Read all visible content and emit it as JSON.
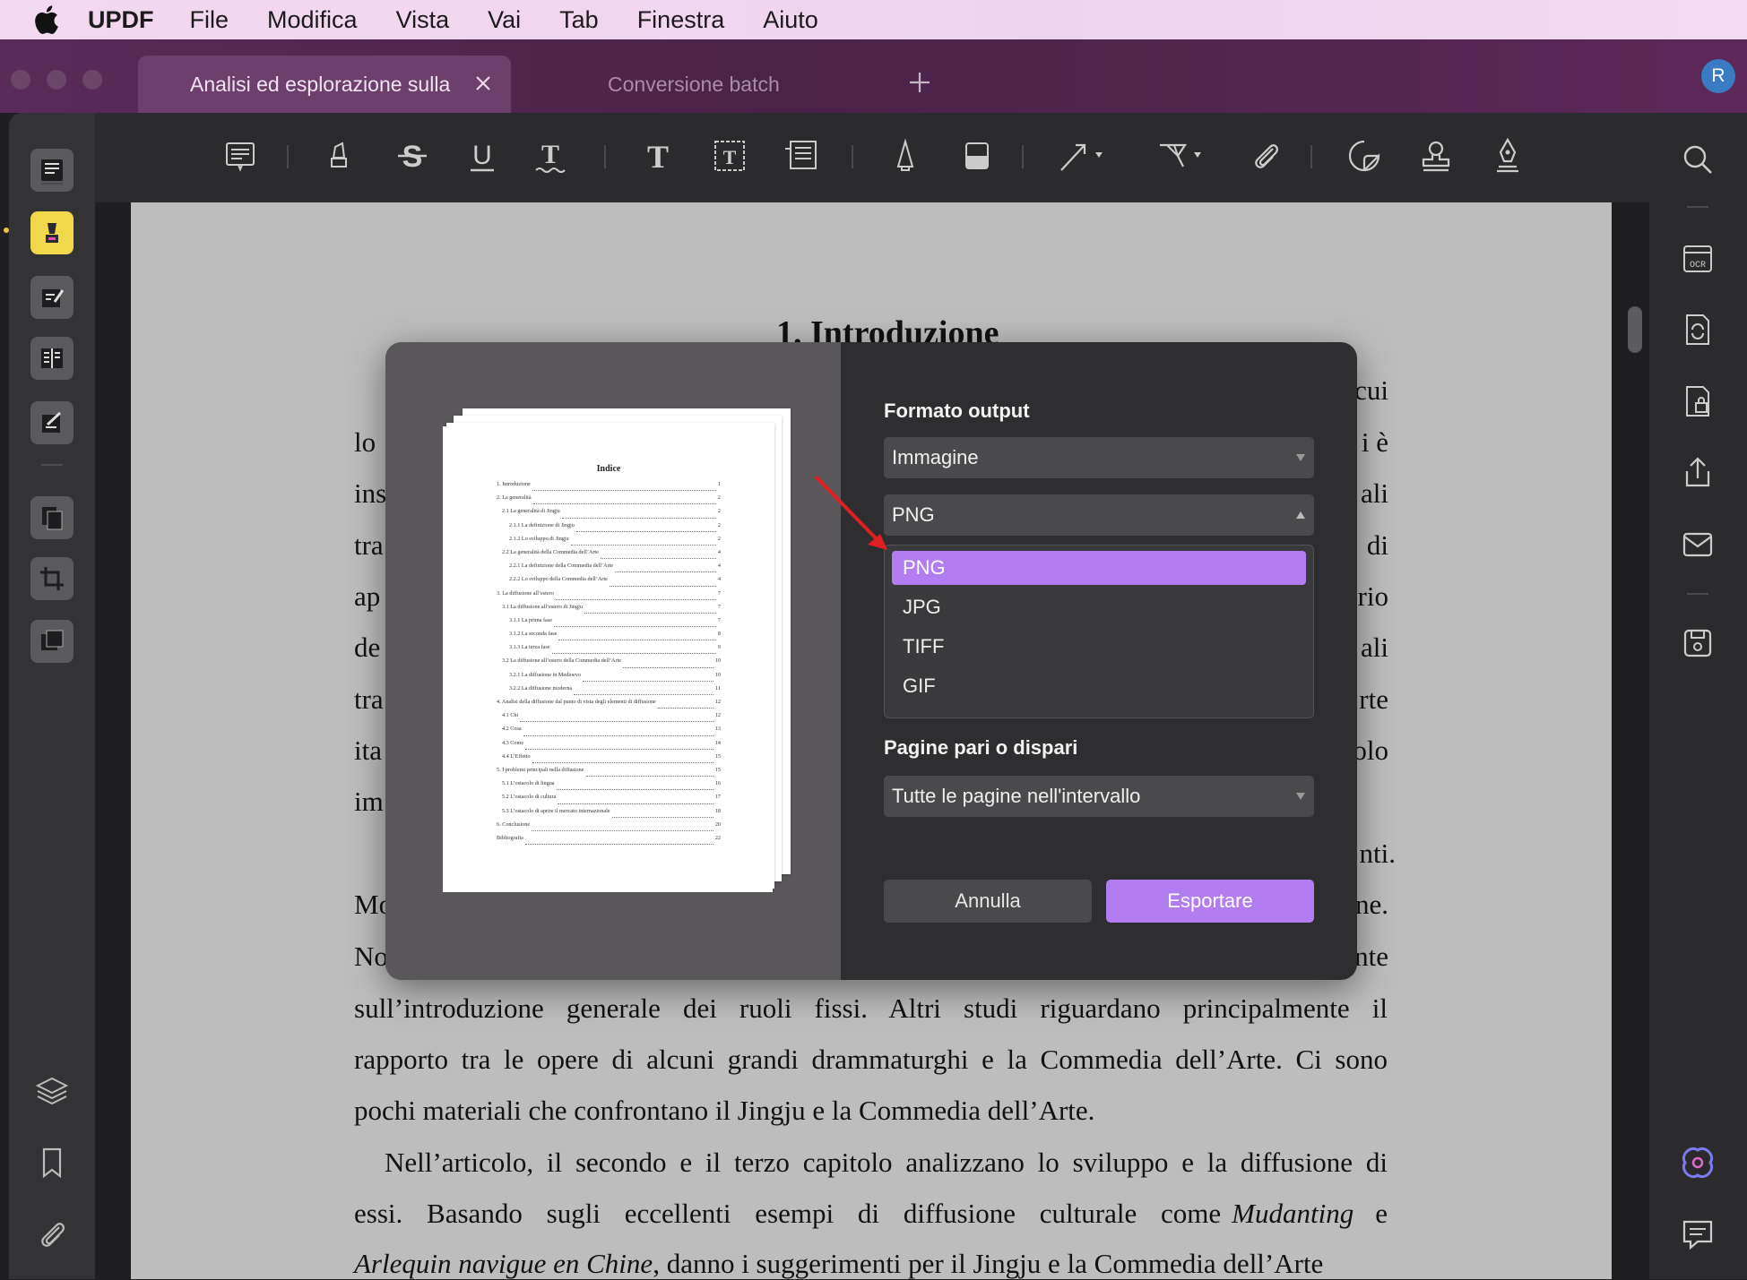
{
  "menubar": {
    "app": "UPDF",
    "items": [
      "File",
      "Modifica",
      "Vista",
      "Vai",
      "Tab",
      "Finestra",
      "Aiuto"
    ]
  },
  "tabs": {
    "active": "Analisi ed esplorazione sulla",
    "second": "Conversione batch",
    "avatar": "R"
  },
  "document": {
    "title": "1. Introduzione",
    "left_fragments": [
      "lo",
      "ins",
      "tra",
      "ap",
      "de",
      "tra",
      "ita",
      "im",
      "Mo",
      "No"
    ],
    "right_fragments": [
      "cui",
      "i è",
      "ali",
      "di",
      "rio",
      "ali",
      "rte",
      "olo",
      "nti.",
      "ne.",
      "nte"
    ],
    "lines": [
      "sull’introduzione generale dei ruoli fissi. Altri studi riguardano principalmente il",
      "rapporto tra le opere di alcuni grandi drammaturghi e la Commedia dell’Arte. Ci sono",
      "pochi materiali che confrontano il Jingju e la Commedia dell’Arte."
    ],
    "para2_line1": "Nell’articolo, il secondo e il terzo capitolo analizzano lo sviluppo e la diffusione di",
    "para2_line2_a": "essi. Basando sugli eccellenti esempi di diffusione culturale come",
    "para2_line2_italic": "Mudanting",
    "para2_line2_b": "e",
    "para2_line3_italic": "Arlequin navigue en Chine",
    "para2_line3_b": ", danno i suggerimenti per il Jingju e la Commedia dell’Arte"
  },
  "preview": {
    "title": "Indice",
    "entries": [
      {
        "t": "1. Introduzione",
        "p": "1"
      },
      {
        "t": "2. La generalità",
        "p": "2"
      },
      {
        "t": "2.1 La generalità di Jingju",
        "p": "2"
      },
      {
        "t": "2.1.1 La definizione di Jingju",
        "p": "2"
      },
      {
        "t": "2.1.2 Lo sviluppo di Jingju",
        "p": "2"
      },
      {
        "t": "2.2 La generalità della Commedia dell’Arte",
        "p": "4"
      },
      {
        "t": "2.2.1 La definizione della Commedia dell’Arte",
        "p": "4"
      },
      {
        "t": "2.2.2 Lo sviluppo della Commedia dell’Arte",
        "p": "4"
      },
      {
        "t": "3. La diffusione all’estero",
        "p": "7"
      },
      {
        "t": "3.1 La diffusione all’estero di Jingju",
        "p": "7"
      },
      {
        "t": "3.1.1 La prima fase",
        "p": "7"
      },
      {
        "t": "3.1.2 La seconda fase",
        "p": "8"
      },
      {
        "t": "3.1.3 La terza fase",
        "p": "9"
      },
      {
        "t": "3.2 La diffusione all’estero della Commedia dell’Arte",
        "p": "10"
      },
      {
        "t": "3.2.1 La diffusione in Medioevo",
        "p": "10"
      },
      {
        "t": "3.2.2 La diffusione moderna",
        "p": "11"
      },
      {
        "t": "4. Analisi della diffusione dal punto di vista degli elementi di diffusione",
        "p": "12"
      },
      {
        "t": "4.1 Chi",
        "p": "12"
      },
      {
        "t": "4.2 Cosa",
        "p": "13"
      },
      {
        "t": "4.3 Come",
        "p": "14"
      },
      {
        "t": "4.4 L’Effetto",
        "p": "15"
      },
      {
        "t": "5. I problemi principali nella diffusione",
        "p": "15"
      },
      {
        "t": "5.1 L’ostacolo di lingua",
        "p": "16"
      },
      {
        "t": "5.2 L’ostacolo di cultura",
        "p": "17"
      },
      {
        "t": "5.3 L’ostacolo di aprire il mercato internazionale",
        "p": "18"
      },
      {
        "t": "6. Conclusione",
        "p": "20"
      },
      {
        "t": "Bibliografia",
        "p": "22"
      }
    ]
  },
  "dialog": {
    "output_label": "Formato output",
    "output_value": "Immagine",
    "format_value": "PNG",
    "format_options": [
      "PNG",
      "JPG",
      "TIFF",
      "GIF"
    ],
    "pages_label": "Pagine pari o dispari",
    "pages_value": "Tutte le pagine nell'intervallo",
    "cancel": "Annulla",
    "export": "Esportare"
  },
  "colors": {
    "accent": "#b17df0",
    "highlight_tool": "#f0d84a",
    "annotation_arrow": "#e02020"
  }
}
